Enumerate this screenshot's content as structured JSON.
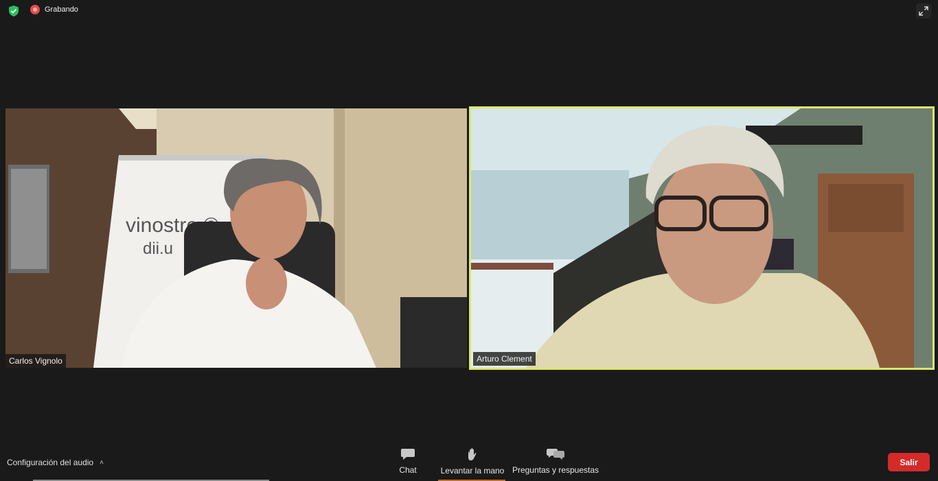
{
  "top": {
    "recording_label": "Grabando"
  },
  "participants": [
    {
      "name": "Carlos Vignolo",
      "whiteboard_text_1": "vinostro ©",
      "whiteboard_text_2": "dii.u",
      "active_speaker": false
    },
    {
      "name": "Arturo Clement",
      "active_speaker": true
    }
  ],
  "bottom": {
    "audio_config_label": "Configuración del audio",
    "chat_label": "Chat",
    "raise_hand_label": "Levantar la mano",
    "qa_label": "Preguntas y respuestas",
    "exit_label": "Salir"
  },
  "icons": {
    "security": "shield-check-icon",
    "recording": "record-icon",
    "fullscreen": "expand-icon",
    "audio_menu": "chevron-up-icon",
    "chat": "chat-bubble-icon",
    "raise_hand": "hand-icon",
    "qa": "qa-bubbles-icon"
  },
  "colors": {
    "background": "#1a1a1a",
    "active_speaker_border": "#dbe86a",
    "exit_button": "#d42a2a",
    "security_green": "#2bbf5c",
    "recording_red": "#e34b4b"
  }
}
